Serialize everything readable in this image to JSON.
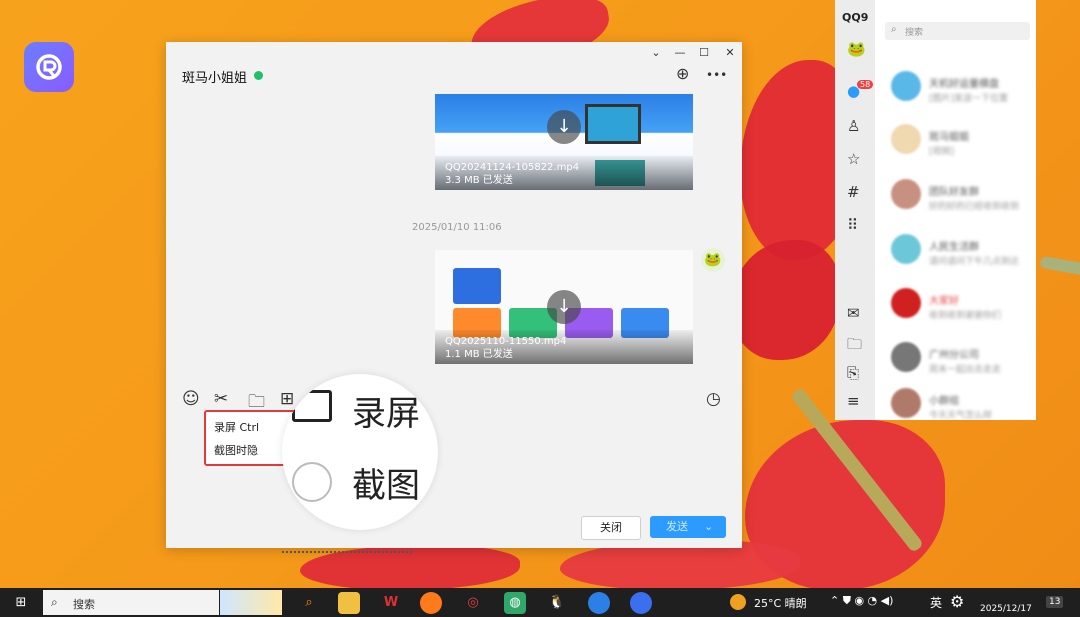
{
  "desktop": {
    "app_logo_icon": "r-logo-icon"
  },
  "chat_window": {
    "title": "斑马小姐姐",
    "status_color": "#1fc06b",
    "window_controls": {
      "dropdown": "⌄",
      "minimize": "—",
      "maximize": "☐",
      "close": "✕"
    },
    "top_actions": {
      "add": "⊕",
      "more": "•••"
    },
    "messages": [
      {
        "file_name": "QQ20241124-105822.mp4",
        "file_size": "3.3 MB 已发送"
      },
      {
        "file_name": "QQ2025110-11550.mp4",
        "file_size": "1.1 MB 已发送"
      }
    ],
    "timestamp": "2025/01/10 11:06",
    "toolbar": {
      "emoji": "☺",
      "scissors": "✂",
      "folder": "🗀",
      "image": "⊞",
      "history": "◷"
    },
    "screenshot_menu": {
      "record_label": "录屏 Ctrl",
      "hide_label": "截图时隐"
    },
    "magnifier": {
      "record_label": "录屏",
      "screenshot_label": "截图"
    },
    "buttons": {
      "close": "关闭",
      "send": "发送"
    },
    "accent_color": "#2b9bff",
    "highlight_color": "#e03a3a"
  },
  "qq_panel": {
    "logo": "QQ9",
    "search_placeholder": "搜索",
    "unread_badge": "58",
    "sidebar_icons": [
      "avatar-icon",
      "message-icon",
      "contacts-icon",
      "star-icon",
      "hashtag-icon",
      "apps-grid-icon",
      "mail-icon",
      "folder-icon",
      "bookmark-icon",
      "menu-icon"
    ],
    "contacts": [
      {
        "name": "天机好运量横盘",
        "preview": "[图片]发送一下位置",
        "time": ""
      },
      {
        "name": "斑马姐姐",
        "preview": "[视频]",
        "time": ""
      },
      {
        "name": "团队好友群",
        "preview": "好的好的已经收到收到",
        "time": ""
      },
      {
        "name": "人民生活群",
        "preview": "请问请问下午几点到达",
        "time": ""
      },
      {
        "name": "大家好",
        "preview": "收到收到谢谢你们",
        "time": ""
      },
      {
        "name": "广州分公司",
        "preview": "周末一起出去走走",
        "time": ""
      },
      {
        "name": "小群组",
        "preview": "今天天气怎么样",
        "time": ""
      }
    ]
  },
  "taskbar": {
    "search_placeholder": "搜索",
    "weather": "25°C 晴朗",
    "language": "英",
    "time": "",
    "date": "2025/12/17",
    "notification_count": "13"
  }
}
